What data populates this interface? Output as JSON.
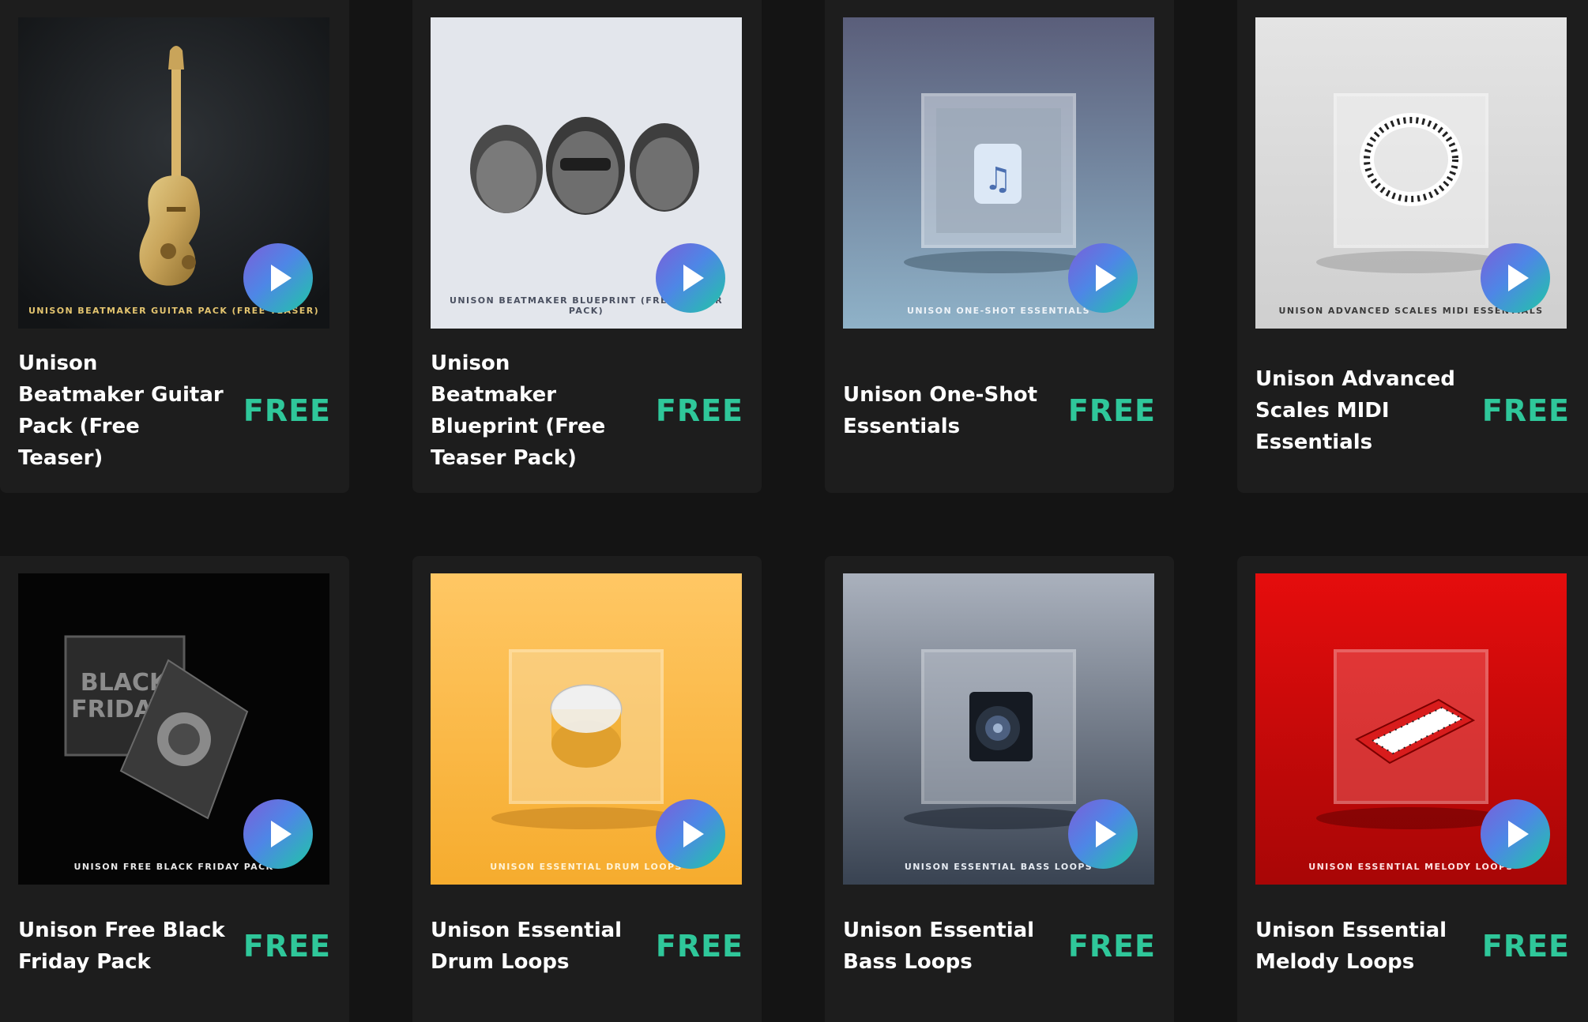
{
  "products": [
    {
      "title": "Unison Beatmaker Guitar Pack (Free Teaser)",
      "price": "FREE",
      "caption": "UNISON BEATMAKER GUITAR PACK (FREE TEASER)"
    },
    {
      "title": "Unison Beatmaker Blueprint (Free Teaser Pack)",
      "price": "FREE",
      "caption": "UNISON BEATMAKER BLUEPRINT (FREE TEASER PACK)"
    },
    {
      "title": "Unison One-Shot Essentials",
      "price": "FREE",
      "caption": "UNISON ONE-SHOT ESSENTIALS"
    },
    {
      "title": "Unison Advanced Scales MIDI Essentials",
      "price": "FREE",
      "caption": "UNISON ADVANCED SCALES MIDI ESSENTIALS"
    },
    {
      "title": "Unison Free Black Friday Pack",
      "price": "FREE",
      "caption": "UNISON FREE BLACK FRIDAY PACK",
      "art_text": [
        "BLACK",
        "FRIDAY"
      ]
    },
    {
      "title": "Unison Essential Drum Loops",
      "price": "FREE",
      "caption": "UNISON ESSENTIAL DRUM LOOPS"
    },
    {
      "title": "Unison Essential Bass Loops",
      "price": "FREE",
      "caption": "UNISON ESSENTIAL BASS LOOPS"
    },
    {
      "title": "Unison Essential Melody Loops",
      "price": "FREE",
      "caption": "UNISON ESSENTIAL MELODY LOOPS"
    }
  ],
  "icons": {
    "play": "play-icon"
  },
  "colors": {
    "price": "#2fc79a",
    "card": "#1d1d1d",
    "background": "#141414"
  }
}
